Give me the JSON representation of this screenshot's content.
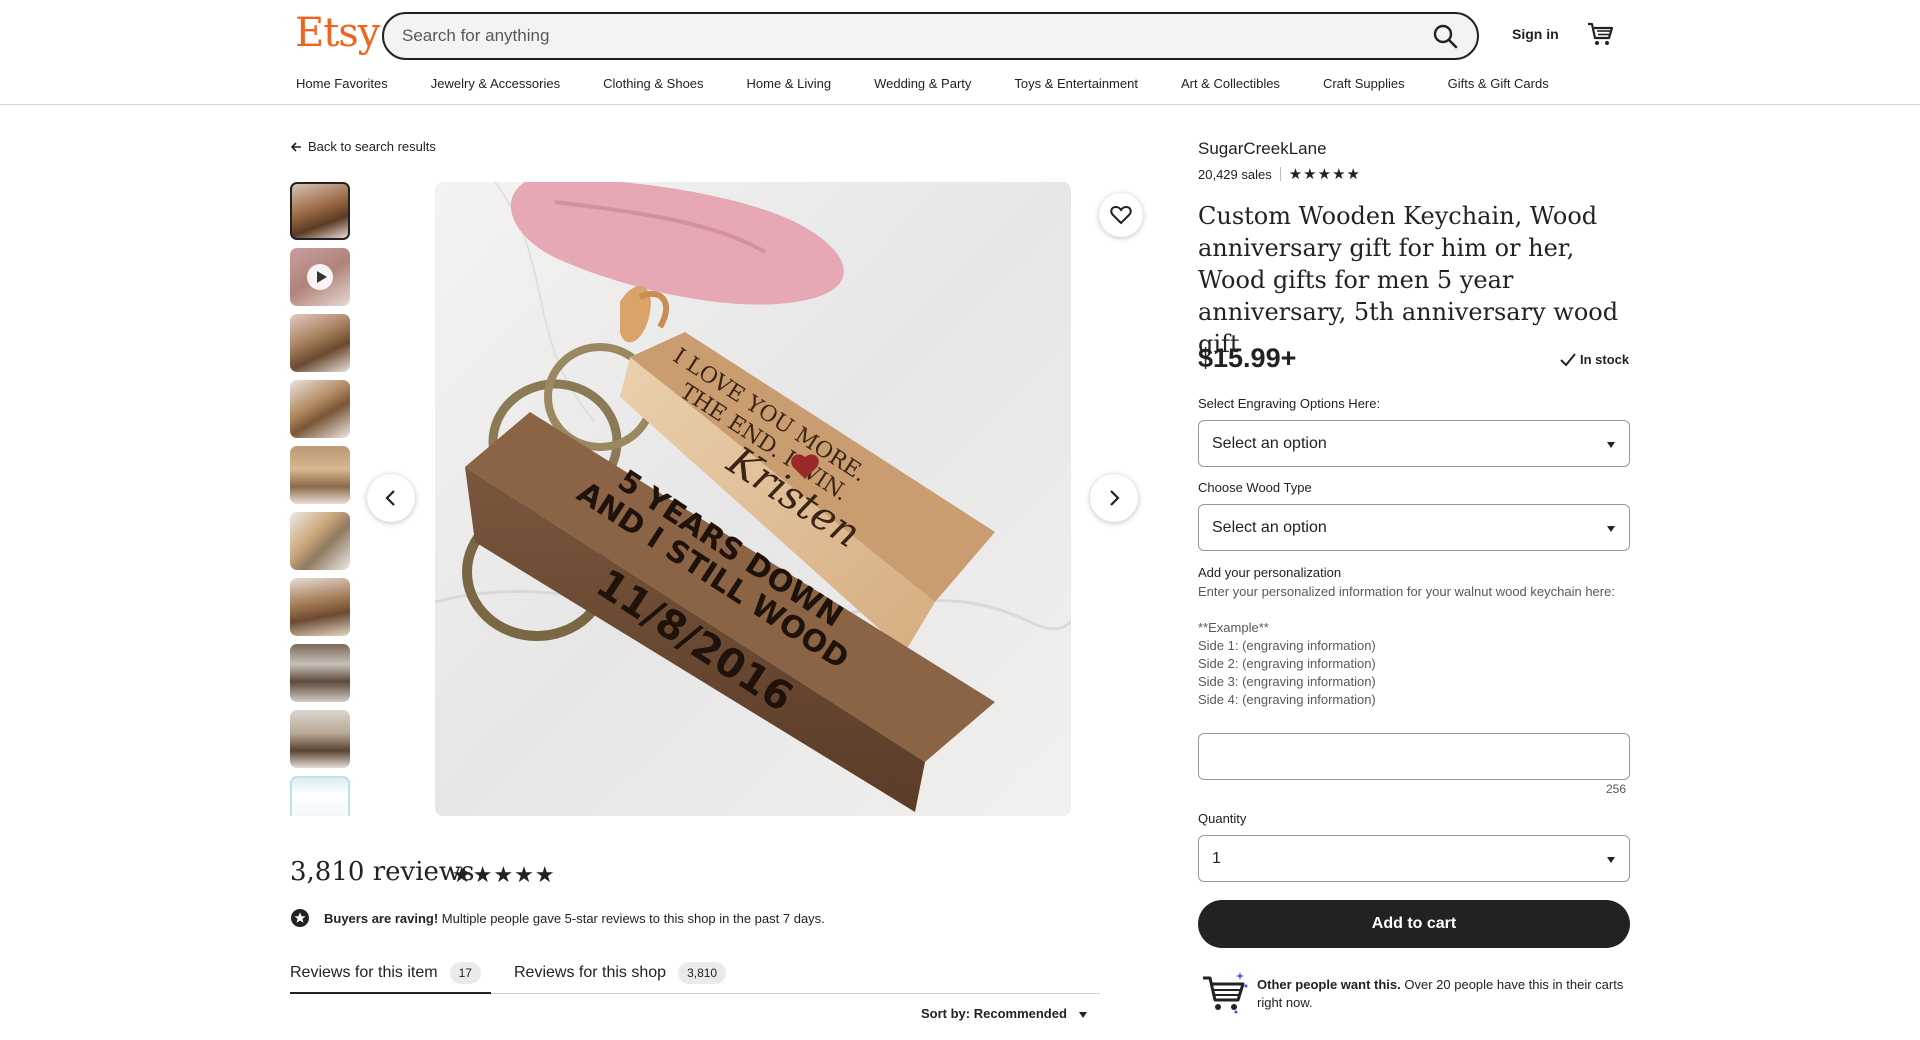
{
  "header": {
    "logo": "Etsy",
    "search_placeholder": "Search for anything",
    "signin_label": "Sign in",
    "categories": [
      "Home Favorites",
      "Jewelry & Accessories",
      "Clothing & Shoes",
      "Home & Living",
      "Wedding & Party",
      "Toys & Entertainment",
      "Art & Collectibles",
      "Craft Supplies",
      "Gifts & Gift Cards"
    ]
  },
  "back_link": "Back to search results",
  "reviews": {
    "title": "3,810 reviews",
    "stars": "★★★★★",
    "raving_bold": "Buyers are raving!",
    "raving_text": "Multiple people gave 5-star reviews to this shop in the past 7 days.",
    "tab_item_label": "Reviews for this item",
    "tab_item_count": "17",
    "tab_shop_label": "Reviews for this shop",
    "tab_shop_count": "3,810",
    "sort_label": "Sort by: Recommended"
  },
  "listing": {
    "shop_name": "SugarCreekLane",
    "sales": "20,429 sales",
    "stars": "★★★★★",
    "title": "Custom Wooden Keychain, Wood anniversary gift for him or her, Wood gifts for men 5 year anniversary, 5th anniversary wood gift",
    "price": "$15.99+",
    "stock": "In stock",
    "engraving_label": "Select Engraving Options Here:",
    "engraving_value": "Select an option",
    "wood_label": "Choose Wood Type",
    "wood_value": "Select an option",
    "personalization_title": "Add your personalization",
    "personalization_lines": [
      "Enter your personalized information for your walnut wood keychain here:",
      "",
      "**Example**",
      "Side 1: (engraving information)",
      "Side 2: (engraving information)",
      "Side 3: (engraving information)",
      "Side 4: (engraving information)"
    ],
    "personalization_count": "256",
    "quantity_label": "Quantity",
    "quantity_value": "1",
    "add_to_cart": "Add to cart",
    "other_bold": "Other people want this.",
    "other_text": "Over 20 people have this in their carts right now."
  },
  "image_text": {
    "light_bar_line1": "I LOVE YOU MORE.",
    "light_bar_line2": "THE END. I WIN.",
    "light_bar_name": "Kristen",
    "dark_bar_line1": "5 YEARS DOWN",
    "dark_bar_line2": "AND I STILL WOOD",
    "dark_bar_date": "11/8/2016"
  },
  "colors": {
    "brand": "#f1641e",
    "text": "#222222",
    "cart_button": "#222222"
  }
}
